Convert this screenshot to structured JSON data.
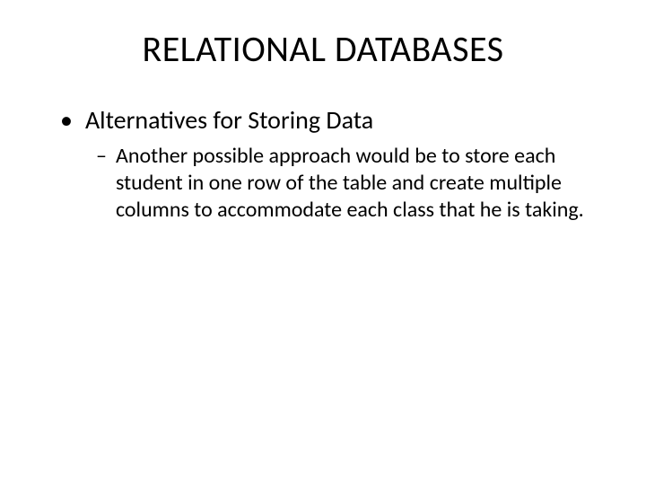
{
  "slide": {
    "title": "RELATIONAL DATABASES",
    "bullets": [
      {
        "marker": "•",
        "text": "Alternatives for Storing Data",
        "children": [
          {
            "marker": "–",
            "text": "Another possible approach would be to store each student in one row of the table and create multiple columns to accommodate each class that he is taking."
          }
        ]
      }
    ]
  }
}
